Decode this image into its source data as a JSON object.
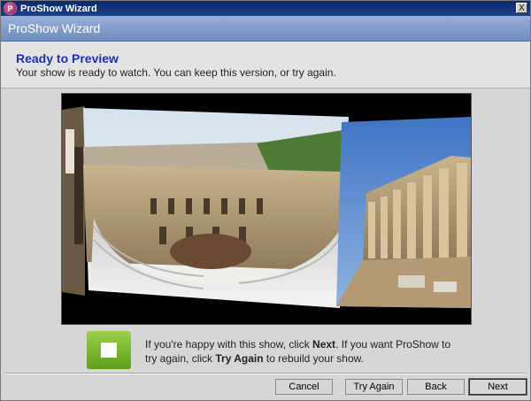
{
  "window": {
    "title": "ProShow Wizard",
    "banner": "ProShow Wizard",
    "close_glyph": "X",
    "icon_letter": "P"
  },
  "header": {
    "title": "Ready to Preview",
    "subtitle": "Your show is ready to watch. You can keep this version, or try again."
  },
  "preview": {
    "icon": "slideshow-preview"
  },
  "info": {
    "icon": "stop-square-icon",
    "part1": "If you're happy with this show, click ",
    "next_word": "Next",
    "part2": ". If you want ProShow to try again, click ",
    "try_word": "Try Again",
    "part3": " to rebuild your show."
  },
  "buttons": {
    "cancel": "Cancel",
    "try_again": "Try Again",
    "back": "Back",
    "next": "Next"
  },
  "colors": {
    "title_blue": "#1a31b8",
    "banner": "#7e98c9",
    "titlebar": "#0a2a6b",
    "green_icon": "#6fae2a"
  }
}
